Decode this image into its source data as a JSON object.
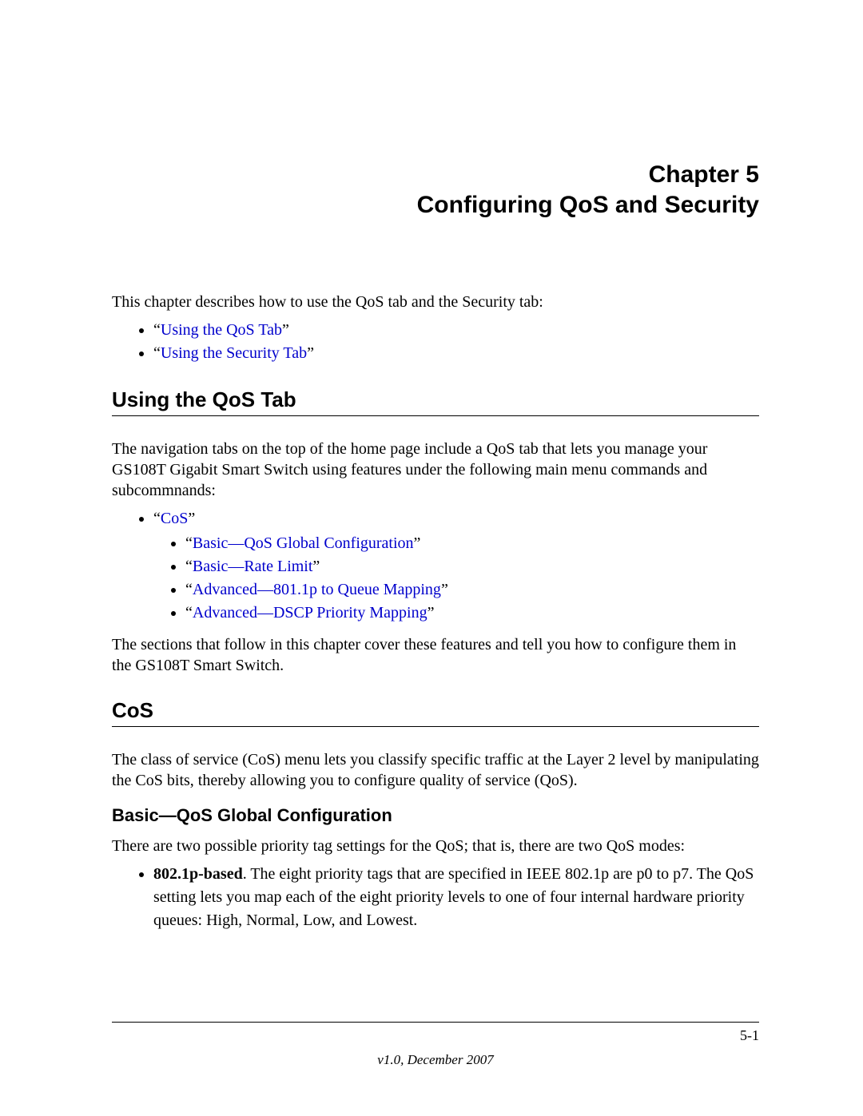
{
  "header": {
    "chapter_line1": "Chapter 5",
    "chapter_line2": "Configuring QoS and Security"
  },
  "intro_paragraph": "This chapter describes how to use the QoS tab and the Security tab:",
  "intro_links": [
    "Using the QoS Tab",
    "Using the Security Tab"
  ],
  "section1": {
    "title": "Using the QoS Tab",
    "paragraph": "The navigation tabs on the top of the home page include a QoS tab that lets you manage your GS108T Gigabit Smart Switch using features under the following main menu commands and subcommnands:",
    "bullets": [
      {
        "label": "CoS",
        "children": [
          "Basic—QoS Global Configuration",
          "Basic—Rate Limit",
          "Advanced—801.1p to Queue Mapping",
          "Advanced—DSCP Priority Mapping"
        ]
      }
    ],
    "closing": "The sections that follow in this chapter cover these features and tell you how to configure them in the GS108T Smart Switch."
  },
  "section2": {
    "title": "CoS",
    "paragraph": "The class of service (CoS) menu lets you classify specific traffic at the Layer 2 level by manipulating the CoS bits, thereby allowing you to configure quality of service (QoS)."
  },
  "section3": {
    "title": "Basic—QoS Global Configuration",
    "paragraph": "There are two possible priority tag settings for the QoS; that is, there are two QoS modes:",
    "bullet_bold": "802.1p-based",
    "bullet_rest": ". The eight priority tags that are specified in IEEE 802.1p are p0 to p7. The QoS setting lets you map each of the eight priority levels to one of four internal hardware priority queues: High, Normal, Low, and Lowest."
  },
  "footer": {
    "page_number": "5-1",
    "version": "v1.0, December 2007"
  }
}
